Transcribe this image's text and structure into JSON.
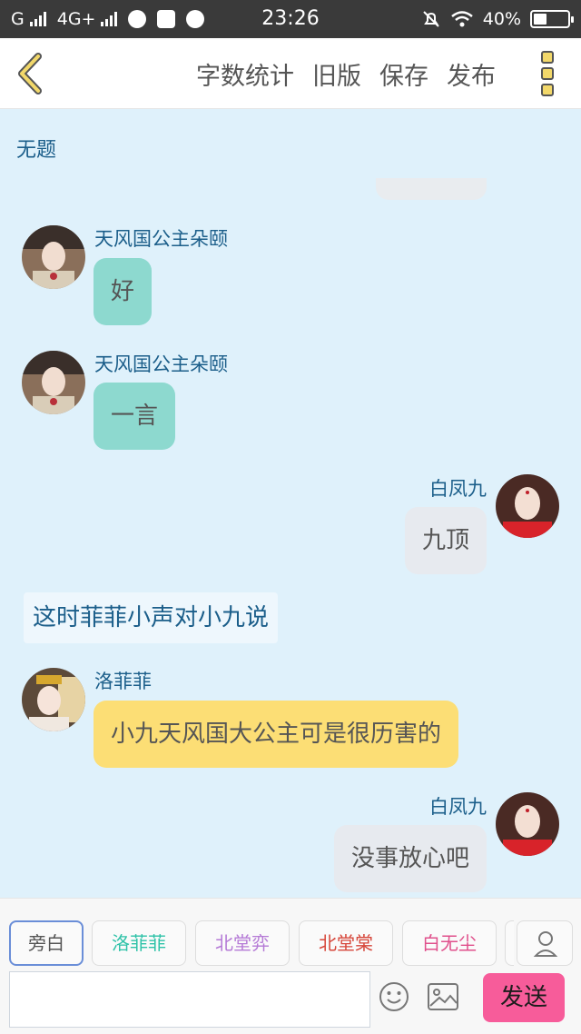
{
  "status_bar": {
    "carrier": "G",
    "network": "4G+",
    "time": "23:26",
    "battery": "40%",
    "battery_level": 0.4
  },
  "toolbar": {
    "actions": [
      "字数统计",
      "旧版",
      "保存",
      "发布"
    ]
  },
  "story_title": "无题",
  "messages": [
    {
      "speaker": "天风国公主朵颐",
      "text": "好"
    },
    {
      "speaker": "天风国公主朵颐",
      "text": "一言"
    },
    {
      "speaker": "白凤九",
      "text": "九顶"
    },
    {
      "narration": "这时菲菲小声对小九说"
    },
    {
      "speaker": "洛菲菲",
      "text": "小九天风国大公主可是很历害的"
    },
    {
      "speaker": "白凤九",
      "text": "没事放心吧"
    }
  ],
  "roles": [
    {
      "label": "旁白",
      "color": "#555555",
      "selected": true
    },
    {
      "label": "洛菲菲",
      "color": "#2ec2a8",
      "selected": false
    },
    {
      "label": "北堂弈",
      "color": "#b57ad6",
      "selected": false
    },
    {
      "label": "北堂棠",
      "color": "#d6463a",
      "selected": false
    },
    {
      "label": "白无尘",
      "color": "#e0508c",
      "selected": false
    }
  ],
  "input": {
    "placeholder": "",
    "value": ""
  },
  "send_label": "发送",
  "icons": [
    "back-icon",
    "more-icon",
    "person-icon",
    "emoji-icon",
    "image-icon"
  ]
}
